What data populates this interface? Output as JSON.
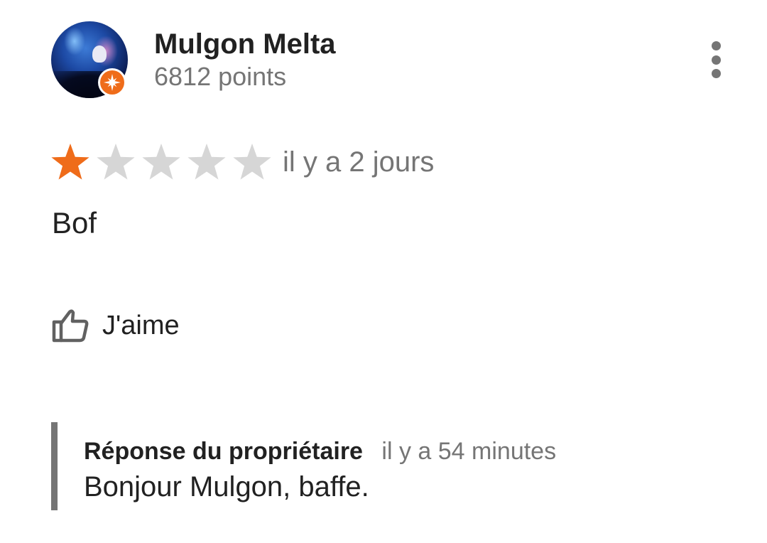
{
  "reviewer": {
    "name": "Mulgon Melta",
    "points": "6812 points",
    "badge": "local-guide-badge"
  },
  "rating": {
    "stars_total": 5,
    "stars_filled": 1,
    "filled_color": "#ef6c1a",
    "empty_color": "#d6d6d6",
    "time": "il y a 2 jours"
  },
  "review": {
    "text": "Bof"
  },
  "actions": {
    "like_label": "J'aime",
    "more_icon": "more-vertical-icon"
  },
  "owner_reply": {
    "title": "Réponse du propriétaire",
    "time": "il y a 54 minutes",
    "text": "Bonjour Mulgon, baffe."
  }
}
